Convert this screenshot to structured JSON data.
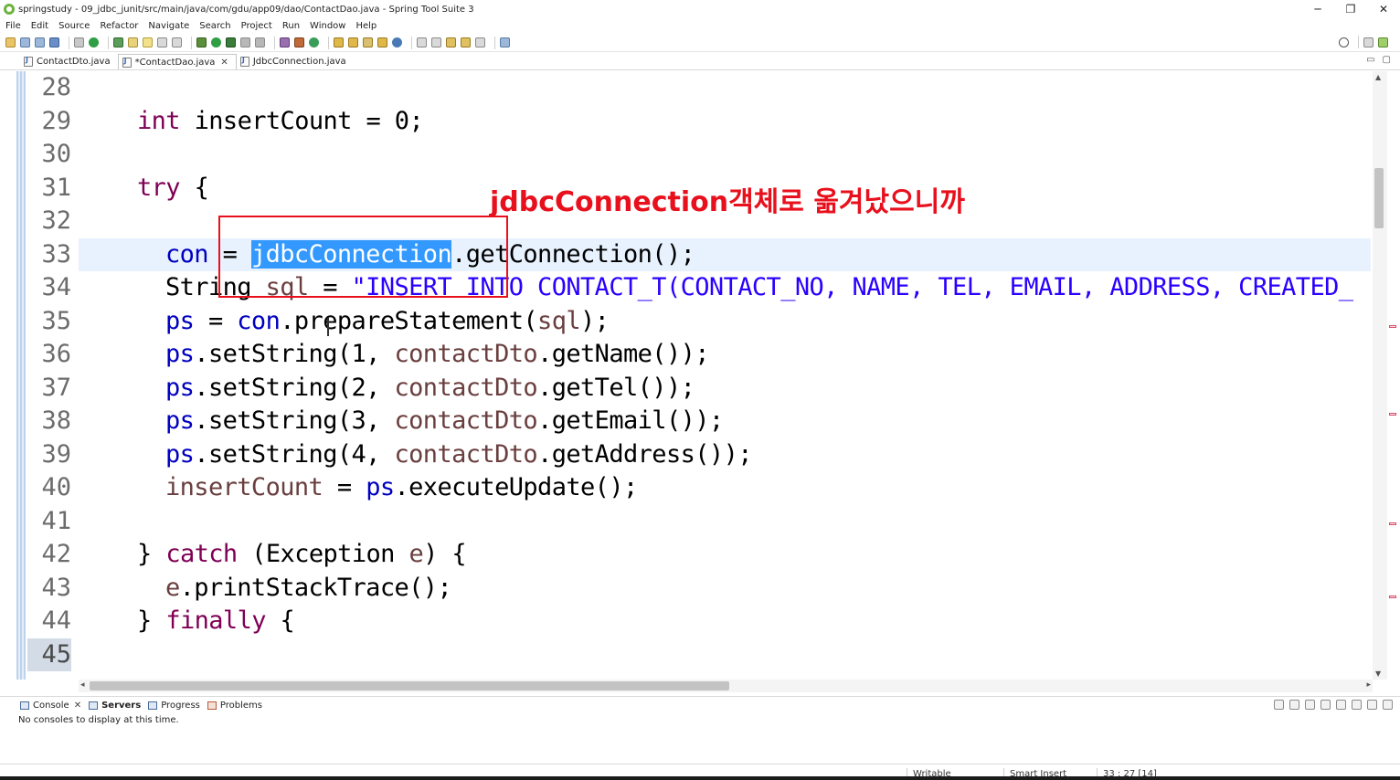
{
  "window": {
    "title": "springstudy - 09_jdbc_junit/src/main/java/com/gdu/app09/dao/ContactDao.java - Spring Tool Suite 3",
    "minimize": "─",
    "restore": "❐",
    "close": "✕"
  },
  "menu": [
    "File",
    "Edit",
    "Source",
    "Refactor",
    "Navigate",
    "Search",
    "Project",
    "Run",
    "Window",
    "Help"
  ],
  "editor_tabs": [
    {
      "label": "ContactDto.java",
      "active": false
    },
    {
      "label": "*ContactDao.java",
      "active": true,
      "close": "✕"
    },
    {
      "label": "JdbcConnection.java",
      "active": false
    }
  ],
  "editor_controls": {
    "minimize": "▭",
    "maximize": "▢"
  },
  "code": {
    "lines": [
      {
        "num": "28"
      },
      {
        "num": "29",
        "t": {
          "kw": "int",
          "rest": " insertCount = 0;"
        }
      },
      {
        "num": "30"
      },
      {
        "num": "31",
        "t": {
          "kw": "try",
          "rest": " {"
        }
      },
      {
        "num": "32"
      },
      {
        "num": "33",
        "t": {
          "fld1": "con",
          "eq": " = ",
          "sel": "jdbcConnection",
          "rest": ".getConnection();"
        }
      },
      {
        "num": "34",
        "t": {
          "plain": "String ",
          "var": "sql",
          "eq": " = ",
          "str": "\"INSERT INTO CONTACT_T(CONTACT_NO, NAME, TEL, EMAIL, ADDRESS, CREATED_"
        }
      },
      {
        "num": "35",
        "t": {
          "fld1": "ps",
          "eq": " = ",
          "fld2": "con",
          "rest": ".prepareStatement(",
          "var": "sql",
          "end": ");"
        }
      },
      {
        "num": "36",
        "t": {
          "fld1": "ps",
          "rest": ".setString(1, ",
          "var": "contactDto",
          "end": ".getName());"
        }
      },
      {
        "num": "37",
        "t": {
          "fld1": "ps",
          "rest": ".setString(2, ",
          "var": "contactDto",
          "end": ".getTel());"
        }
      },
      {
        "num": "38",
        "t": {
          "fld1": "ps",
          "rest": ".setString(3, ",
          "var": "contactDto",
          "end": ".getEmail());"
        }
      },
      {
        "num": "39",
        "t": {
          "fld1": "ps",
          "rest": ".setString(4, ",
          "var": "contactDto",
          "end": ".getAddress());"
        }
      },
      {
        "num": "40",
        "t": {
          "var": "insertCount",
          "eq": " = ",
          "fld1": "ps",
          "end": ".executeUpdate();"
        }
      },
      {
        "num": "41"
      },
      {
        "num": "42",
        "t": {
          "plain": "} ",
          "kw": "catch",
          "rest": " (Exception ",
          "var": "e",
          "end": ") {"
        }
      },
      {
        "num": "43",
        "t": {
          "var": "e",
          "end": ".printStackTrace();"
        }
      },
      {
        "num": "44",
        "t": {
          "plain": "} ",
          "kw": "finally",
          "end": " {"
        }
      },
      {
        "num": "45"
      }
    ]
  },
  "annotation": "jdbcConnection객체로 옮겨났으니까",
  "bottom_panel": {
    "tabs": [
      {
        "label": "Console",
        "close": "✕"
      },
      {
        "label": "Servers"
      },
      {
        "label": "Progress"
      },
      {
        "label": "Problems"
      }
    ],
    "message": "No consoles to display at this time."
  },
  "status": {
    "writable": "Writable",
    "insert_mode": "Smart Insert",
    "position": "33 : 27 [14]"
  },
  "colors": {
    "keyword": "#7f0055",
    "field": "#0000c0",
    "string": "#2a00ff",
    "local_variable": "#6a3e3e",
    "selection": "#3399ff",
    "annotation": "#e8101c",
    "current_line": "#e8f2fe"
  }
}
